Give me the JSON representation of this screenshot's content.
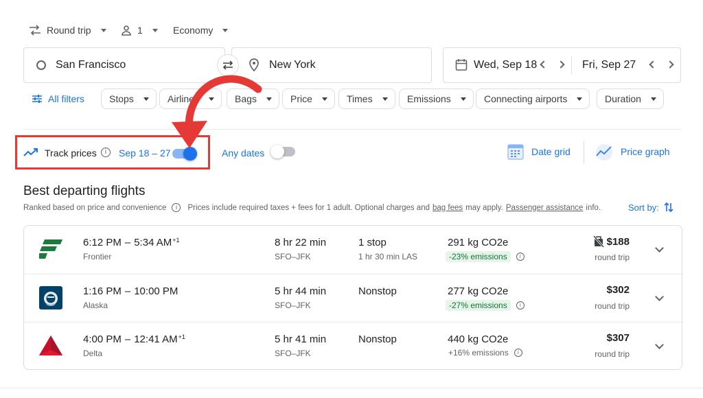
{
  "trip": {
    "type": "Round trip",
    "passengers": "1",
    "cabin": "Economy"
  },
  "search": {
    "origin": "San Francisco",
    "destination": "New York",
    "depart": "Wed, Sep 18",
    "return": "Fri, Sep 27"
  },
  "filters": {
    "all_filters": "All filters",
    "chips": [
      "Stops",
      "Airlines",
      "Bags",
      "Price",
      "Times",
      "Emissions",
      "Connecting airports",
      "Duration"
    ]
  },
  "tracking": {
    "label": "Track prices",
    "dates": "Sep 18 – 27",
    "enabled": true,
    "any_dates": "Any dates",
    "any_dates_enabled": false
  },
  "views": {
    "date_grid": "Date grid",
    "price_graph": "Price graph"
  },
  "results": {
    "title": "Best departing flights",
    "ranked_note": "Ranked based on price and convenience",
    "price_note_prefix": "Prices include required taxes + fees for 1 adult. Optional charges and",
    "bag_fees": "bag fees",
    "may_apply": "may apply.",
    "passenger_assistance": "Passenger assistance",
    "info": "info.",
    "sort_by": "Sort by:"
  },
  "flights": [
    {
      "depart": "6:12 PM",
      "arrive": "5:34 AM",
      "plus_day": "+1",
      "airline": "Frontier",
      "duration": "8 hr 22 min",
      "route": "SFO–JFK",
      "stops": "1 stop",
      "layover": "1 hr 30 min LAS",
      "co2": "291 kg CO2e",
      "emissions": "-23% emissions",
      "emissions_good": true,
      "price": "$188",
      "price_type": "round trip",
      "icon": "no-carry-on-bag-icon"
    },
    {
      "depart": "1:16 PM",
      "arrive": "10:00 PM",
      "plus_day": "",
      "airline": "Alaska",
      "duration": "5 hr 44 min",
      "route": "SFO–JFK",
      "stops": "Nonstop",
      "layover": "",
      "co2": "277 kg CO2e",
      "emissions": "-27% emissions",
      "emissions_good": true,
      "price": "$302",
      "price_type": "round trip"
    },
    {
      "depart": "4:00 PM",
      "arrive": "12:41 AM",
      "plus_day": "+1",
      "airline": "Delta",
      "duration": "5 hr 41 min",
      "route": "SFO–JFK",
      "stops": "Nonstop",
      "layover": "",
      "co2": "440 kg CO2e",
      "emissions": "+16% emissions",
      "emissions_good": false,
      "price": "$307",
      "price_type": "round trip"
    }
  ],
  "colors": {
    "accent": "#1a73e8",
    "highlight": "#e53935",
    "green_badge": "#e6f4ea",
    "green_text": "#137333"
  }
}
